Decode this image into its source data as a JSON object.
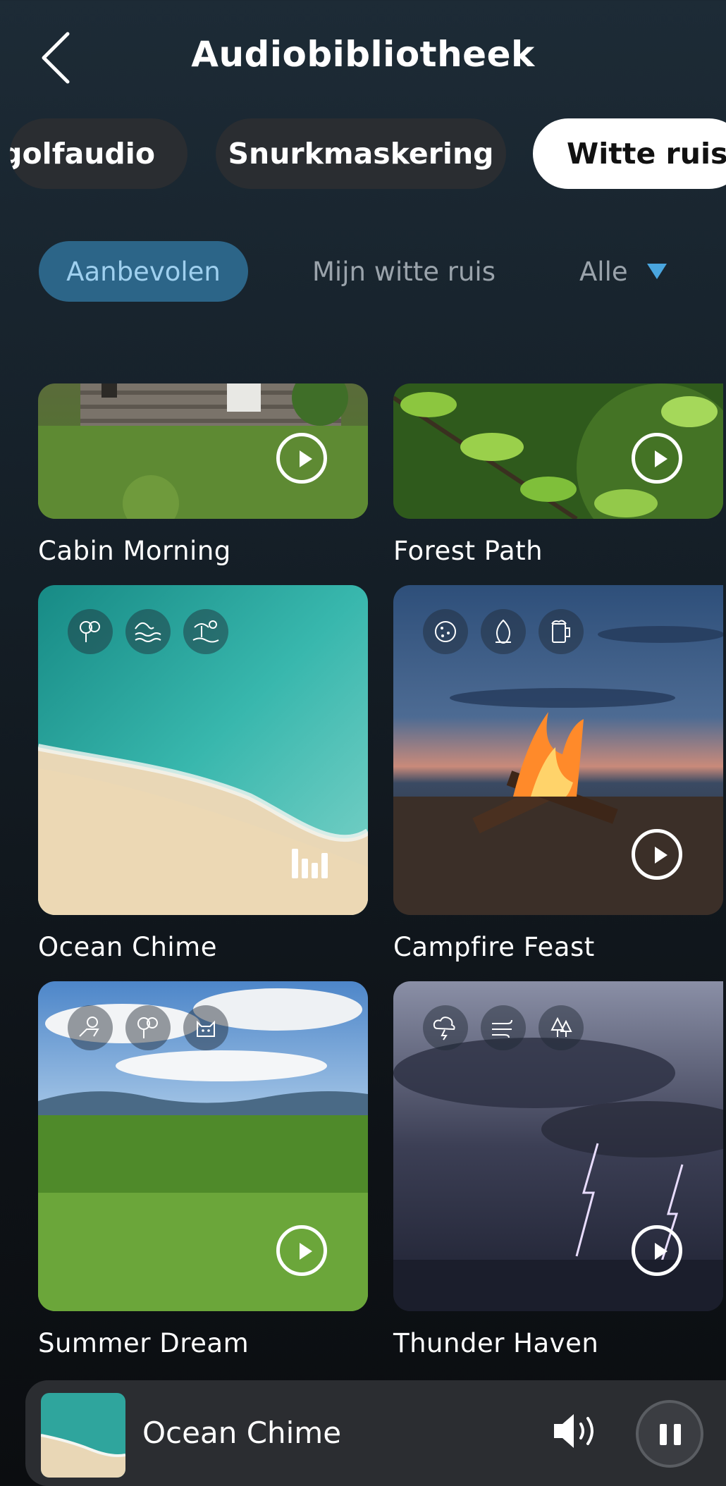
{
  "header": {
    "title": "Audiobibliotheek",
    "back_icon": "chevron-left-icon"
  },
  "categories": [
    {
      "label": "ngolfaudio",
      "selected": false
    },
    {
      "label": "Snurkmaskering",
      "selected": false
    },
    {
      "label": "Witte ruis",
      "selected": true
    }
  ],
  "subtabs": {
    "recommended": "Aanbevolen",
    "mine": "Mijn witte ruis",
    "filter": "Alle"
  },
  "tracks": [
    {
      "title": "Cabin Morning",
      "state": "play"
    },
    {
      "title": "Forest Path",
      "state": "play"
    },
    {
      "title": "Ocean Chime",
      "state": "playing",
      "tags": [
        "rain-tree-icon",
        "waves-icon",
        "beach-sun-icon"
      ]
    },
    {
      "title": "Campfire Feast",
      "state": "play",
      "tags": [
        "cookie-icon",
        "fire-icon",
        "beer-icon"
      ]
    },
    {
      "title": "Summer Dream",
      "state": "play",
      "tags": [
        "lounge-chair-icon",
        "rain-tree-icon",
        "cat-icon"
      ]
    },
    {
      "title": "Thunder Haven",
      "state": "play",
      "tags": [
        "thunder-cloud-icon",
        "wind-icon",
        "forest-rain-icon"
      ]
    }
  ],
  "player": {
    "title": "Ocean Chime",
    "state": "playing"
  },
  "colors": {
    "accent": "#2c6588",
    "accent_text": "#9fd0ef",
    "triangle": "#4aa6df"
  }
}
